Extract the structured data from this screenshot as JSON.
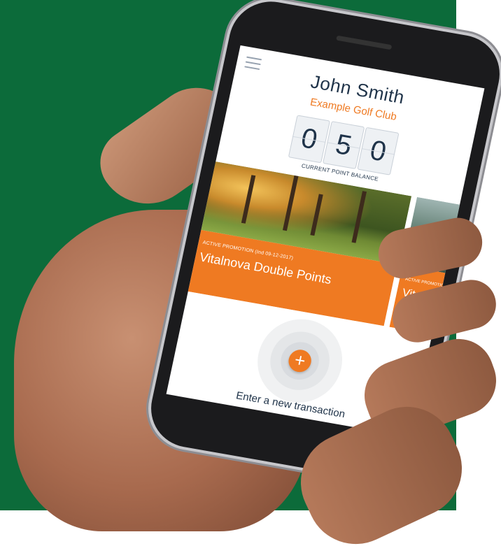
{
  "profile": {
    "name": "John Smith",
    "club": "Example Golf Club"
  },
  "points": {
    "digits": [
      "0",
      "5",
      "0"
    ],
    "label": "CURRENT POINT BALANCE"
  },
  "promotions": [
    {
      "label": "ACTIVE PROMOTION (Ind 09-12-2017)",
      "title": "Vitalnova Double Points"
    },
    {
      "label": "ACTIVE PROMOTION",
      "title": "Vital"
    }
  ],
  "transaction": {
    "button_symbol": "+",
    "label": "Enter a new transaction"
  },
  "colors": {
    "accent": "#ef7a22",
    "text": "#1f3349",
    "background": "#0c6b3a"
  }
}
